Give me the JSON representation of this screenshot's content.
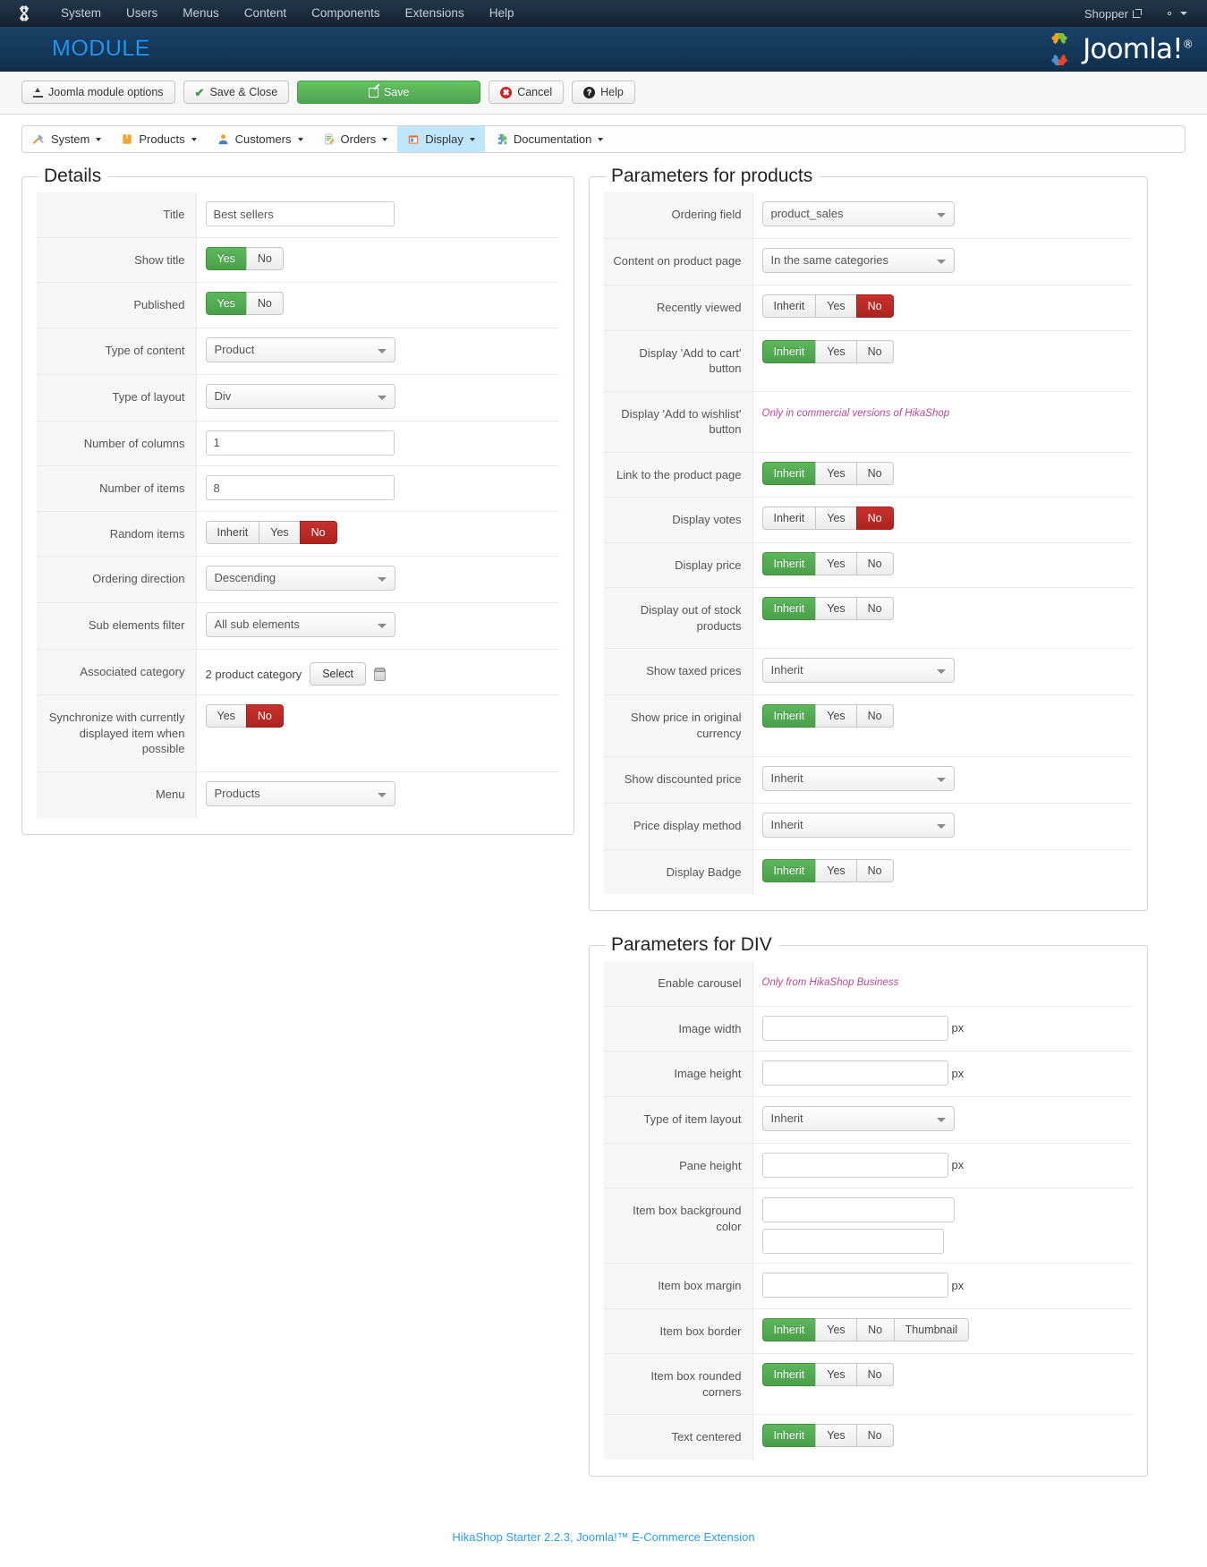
{
  "admin_bar": {
    "logo_icon": "joomla-logo-icon",
    "menu": [
      "System",
      "Users",
      "Menus",
      "Content",
      "Components",
      "Extensions",
      "Help"
    ],
    "shopper_label": "Shopper",
    "shopper_icon": "external-link-icon",
    "gear_icon": "gear-icon",
    "gear_caret_icon": "chevron-down-icon"
  },
  "header": {
    "title": "MODULE",
    "brand": "Joomla!",
    "brand_sup": "®",
    "brand_icon": "joomla-brand-icon",
    "title_color": "#2196f3"
  },
  "toolbar": {
    "buttons": [
      {
        "label": "Joomla module options",
        "icon": "upload-icon",
        "style": "default"
      },
      {
        "label": "Save & Close",
        "icon": "check-icon",
        "style": "default"
      },
      {
        "label": "Save",
        "icon": "pencil-box-icon",
        "style": "primary-green"
      },
      {
        "label": "Cancel",
        "icon": "cancel-circle-icon",
        "style": "default"
      },
      {
        "label": "Help",
        "icon": "question-circle-icon",
        "style": "default"
      }
    ],
    "save_color": "#51a351"
  },
  "hika_menu": {
    "items": [
      {
        "label": "System",
        "icon": "tools-icon",
        "active": false
      },
      {
        "label": "Products",
        "icon": "box-icon",
        "active": false
      },
      {
        "label": "Customers",
        "icon": "user-icon",
        "active": false
      },
      {
        "label": "Orders",
        "icon": "document-pencil-icon",
        "active": false
      },
      {
        "label": "Display",
        "icon": "window-icon",
        "active": true
      },
      {
        "label": "Documentation",
        "icon": "puzzle-icon",
        "active": false
      }
    ],
    "active_bg": "#bfe6fb"
  },
  "details": {
    "legend": "Details",
    "rows": [
      {
        "label": "Title",
        "type": "text",
        "value": "Best sellers"
      },
      {
        "label": "Show title",
        "type": "toggle",
        "options": [
          "Yes",
          "No"
        ],
        "selected": "Yes",
        "selected_style": "green"
      },
      {
        "label": "Published",
        "type": "toggle",
        "options": [
          "Yes",
          "No"
        ],
        "selected": "Yes",
        "selected_style": "green"
      },
      {
        "label": "Type of content",
        "type": "select",
        "value": "Product"
      },
      {
        "label": "Type of layout",
        "type": "select",
        "value": "Div"
      },
      {
        "label": "Number of columns",
        "type": "text",
        "value": "1"
      },
      {
        "label": "Number of items",
        "type": "text",
        "value": "8"
      },
      {
        "label": "Random items",
        "type": "toggle",
        "options": [
          "Inherit",
          "Yes",
          "No"
        ],
        "selected": "No",
        "selected_style": "red"
      },
      {
        "label": "Ordering direction",
        "type": "select",
        "value": "Descending"
      },
      {
        "label": "Sub elements filter",
        "type": "select",
        "value": "All sub elements"
      },
      {
        "label": "Associated category",
        "type": "assoc",
        "value": "2 product category",
        "button": "Select",
        "icon": "trash-icon"
      },
      {
        "label": "Synchronize with currently displayed item when possible",
        "type": "toggle",
        "options": [
          "Yes",
          "No"
        ],
        "selected": "No",
        "selected_style": "red"
      },
      {
        "label": "Menu",
        "type": "select",
        "value": "Products"
      }
    ]
  },
  "products_params": {
    "legend": "Parameters for products",
    "rows": [
      {
        "label": "Ordering field",
        "type": "select",
        "value": "product_sales"
      },
      {
        "label": "Content on product page",
        "type": "select",
        "value": "In the same categories"
      },
      {
        "label": "Recently viewed",
        "type": "toggle",
        "options": [
          "Inherit",
          "Yes",
          "No"
        ],
        "selected": "No",
        "selected_style": "red"
      },
      {
        "label": "Display 'Add to cart' button",
        "type": "toggle",
        "options": [
          "Inherit",
          "Yes",
          "No"
        ],
        "selected": "Inherit",
        "selected_style": "green"
      },
      {
        "label": "Display 'Add to wishlist' button",
        "type": "note",
        "value": "Only in commercial versions of HikaShop"
      },
      {
        "label": "Link to the product page",
        "type": "toggle",
        "options": [
          "Inherit",
          "Yes",
          "No"
        ],
        "selected": "Inherit",
        "selected_style": "green"
      },
      {
        "label": "Display votes",
        "type": "toggle",
        "options": [
          "Inherit",
          "Yes",
          "No"
        ],
        "selected": "No",
        "selected_style": "red"
      },
      {
        "label": "Display price",
        "type": "toggle",
        "options": [
          "Inherit",
          "Yes",
          "No"
        ],
        "selected": "Inherit",
        "selected_style": "green"
      },
      {
        "label": "Display out of stock products",
        "type": "toggle",
        "options": [
          "Inherit",
          "Yes",
          "No"
        ],
        "selected": "Inherit",
        "selected_style": "green"
      },
      {
        "label": "Show taxed prices",
        "type": "select",
        "value": "Inherit"
      },
      {
        "label": "Show price in original currency",
        "type": "toggle",
        "options": [
          "Inherit",
          "Yes",
          "No"
        ],
        "selected": "Inherit",
        "selected_style": "green"
      },
      {
        "label": "Show discounted price",
        "type": "select",
        "value": "Inherit"
      },
      {
        "label": "Price display method",
        "type": "select",
        "value": "Inherit"
      },
      {
        "label": "Display Badge",
        "type": "toggle",
        "options": [
          "Inherit",
          "Yes",
          "No"
        ],
        "selected": "Inherit",
        "selected_style": "green"
      }
    ]
  },
  "div_params": {
    "legend": "Parameters for DIV",
    "rows": [
      {
        "label": "Enable carousel",
        "type": "note",
        "value": "Only from HikaShop Business"
      },
      {
        "label": "Image width",
        "type": "text_px",
        "value": "",
        "suffix": "px"
      },
      {
        "label": "Image height",
        "type": "text_px",
        "value": "",
        "suffix": "px"
      },
      {
        "label": "Type of item layout",
        "type": "select",
        "value": "Inherit"
      },
      {
        "label": "Pane height",
        "type": "text_px",
        "value": "",
        "suffix": "px"
      },
      {
        "label": "Item box background color",
        "type": "two_text",
        "value": "",
        "value2": ""
      },
      {
        "label": "Item box margin",
        "type": "text_px",
        "value": "",
        "suffix": "px"
      },
      {
        "label": "Item box border",
        "type": "toggle",
        "options": [
          "Inherit",
          "Yes",
          "No",
          "Thumbnail"
        ],
        "selected": "Inherit",
        "selected_style": "green"
      },
      {
        "label": "Item box rounded corners",
        "type": "toggle",
        "options": [
          "Inherit",
          "Yes",
          "No"
        ],
        "selected": "Inherit",
        "selected_style": "green"
      },
      {
        "label": "Text centered",
        "type": "toggle",
        "options": [
          "Inherit",
          "Yes",
          "No"
        ],
        "selected": "Inherit",
        "selected_style": "green"
      }
    ]
  },
  "footer": {
    "text": "HikaShop Starter 2.2.3, Joomla!™ E-Commerce Extension",
    "link_color": "#2d9ceb"
  }
}
